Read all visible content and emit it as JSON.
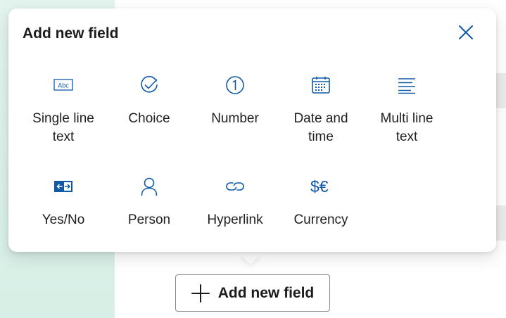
{
  "popup": {
    "title": "Add new field",
    "close_icon": "close-icon"
  },
  "field_types": [
    {
      "label": "Single line\ntext",
      "icon": "text-abc-icon"
    },
    {
      "label": "Choice",
      "icon": "check-circle-icon"
    },
    {
      "label": "Number",
      "icon": "number-one-icon"
    },
    {
      "label": "Date and\ntime",
      "icon": "calendar-icon"
    },
    {
      "label": "Multi line\ntext",
      "icon": "lines-icon"
    },
    {
      "label": "Yes/No",
      "icon": "toggle-arrows-icon"
    },
    {
      "label": "Person",
      "icon": "person-icon"
    },
    {
      "label": "Hyperlink",
      "icon": "link-icon"
    },
    {
      "label": "Currency",
      "icon": "currency-icon"
    }
  ],
  "add_button": {
    "label": "Add new field",
    "icon": "plus-icon"
  },
  "colors": {
    "accent": "#0f5aa8",
    "left_panel": "#dff2ea"
  }
}
